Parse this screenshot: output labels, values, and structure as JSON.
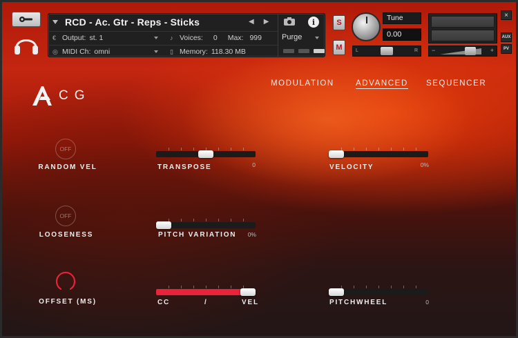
{
  "header": {
    "instrument_name": "RCD - Ac. Gtr - Reps - Sticks",
    "output_label": "Output:",
    "output_value": "st. 1",
    "voices_label": "Voices:",
    "voices_value": "0",
    "max_label": "Max:",
    "max_value": "999",
    "purge_label": "Purge",
    "midi_label": "MIDI Ch:",
    "midi_value": "omni",
    "memory_label": "Memory:",
    "memory_value": "118.30 MB",
    "solo_label": "S",
    "mute_label": "M",
    "tune_label": "Tune",
    "tune_value": "0.00",
    "pan_left": "L",
    "pan_right": "R",
    "vol_minus": "−",
    "vol_plus": "+",
    "close_label": "×",
    "aux_label": "AUX",
    "pv_label": "PV",
    "info_label": "i"
  },
  "brand": {
    "logo_text": "CG"
  },
  "tabs": {
    "modulation": "MODULATION",
    "advanced": "ADVANCED",
    "sequencer": "SEQUENCER"
  },
  "controls": {
    "random_vel": {
      "label": "RANDOM VEL",
      "state": "OFF"
    },
    "looseness": {
      "label": "LOOSENESS",
      "state": "OFF"
    },
    "offset": {
      "label": "OFFSET (MS)"
    },
    "transpose": {
      "label": "TRANSPOSE",
      "value": "0",
      "position": 0.5
    },
    "velocity": {
      "label": "VELOCITY",
      "value": "0%",
      "position": 0.0
    },
    "pitch_variation": {
      "label": "PITCH VARIATION",
      "value": "0%",
      "position": 0.0
    },
    "cc_vel": {
      "label_left": "CC",
      "label_mid": "/",
      "label_right": "VEL",
      "position": 1.0
    },
    "pitchwheel": {
      "label": "PITCHWHEEL",
      "value": "0",
      "position": 0.0
    }
  },
  "colors": {
    "accent": "#e8233a",
    "panel": "#202020"
  }
}
